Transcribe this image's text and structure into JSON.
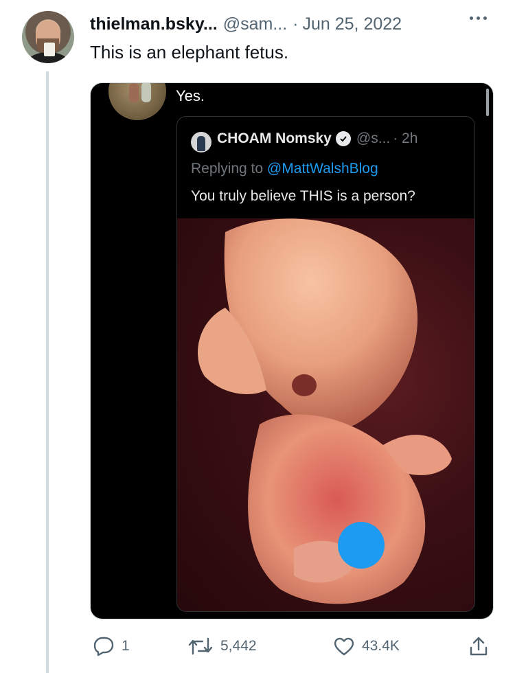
{
  "tweet": {
    "display_name": "thielman.bsky...",
    "handle": "@sam...",
    "separator": "·",
    "date": "Jun 25, 2022",
    "text": "This is an elephant fetus."
  },
  "media": {
    "reply_text": "Yes.",
    "quoted": {
      "display_name": "CHOAM Nomsky",
      "handle": "@s...",
      "time": "· 2h",
      "replying_label": "Replying to",
      "replying_mention": "@MattWalshBlog",
      "text": "You truly believe THIS is a person?"
    }
  },
  "actions": {
    "replies": "1",
    "retweets": "5,442",
    "likes": "43.4K"
  },
  "colors": {
    "accent": "#1d9bf0",
    "muted": "#536471",
    "text": "#0f1419",
    "thread_line": "#cfd9de"
  },
  "icons": [
    "more-icon",
    "verified-icon",
    "reply-icon",
    "retweet-icon",
    "like-icon",
    "share-icon"
  ]
}
